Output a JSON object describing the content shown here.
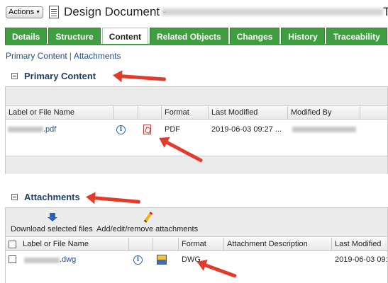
{
  "header": {
    "actions_label": "Actions",
    "title": "Design Document - ",
    "title_tail": "T"
  },
  "tabs": [
    {
      "label": "Details"
    },
    {
      "label": "Structure"
    },
    {
      "label": "Content",
      "active": true
    },
    {
      "label": "Related Objects"
    },
    {
      "label": "Changes"
    },
    {
      "label": "History"
    },
    {
      "label": "Traceability"
    }
  ],
  "subnav": {
    "primary_content": "Primary Content",
    "separator": "|",
    "attachments": "Attachments"
  },
  "primary": {
    "title": "Primary Content",
    "columns": [
      "Label or File Name",
      "",
      "",
      "Format",
      "Last Modified",
      "Modified By"
    ],
    "row": {
      "name_suffix": ".pdf",
      "format": "PDF",
      "last_modified": "2019-06-03 09:27 ..."
    }
  },
  "attachments": {
    "title": "Attachments",
    "download_label": "Download selected files",
    "edit_label": "Add/edit/remove attachments",
    "columns": [
      "Label or File Name",
      "",
      "",
      "Format",
      "Attachment Description",
      "Last Modified"
    ],
    "row": {
      "name_suffix": ".dwg",
      "format": "DWG",
      "last_modified": "2019-06-03 09:"
    }
  },
  "colors": {
    "tab_green": "#3f9e3f",
    "link_blue": "#1f4f88",
    "heading_navy": "#1e3f66",
    "arrow_red": "#e23b2b"
  }
}
